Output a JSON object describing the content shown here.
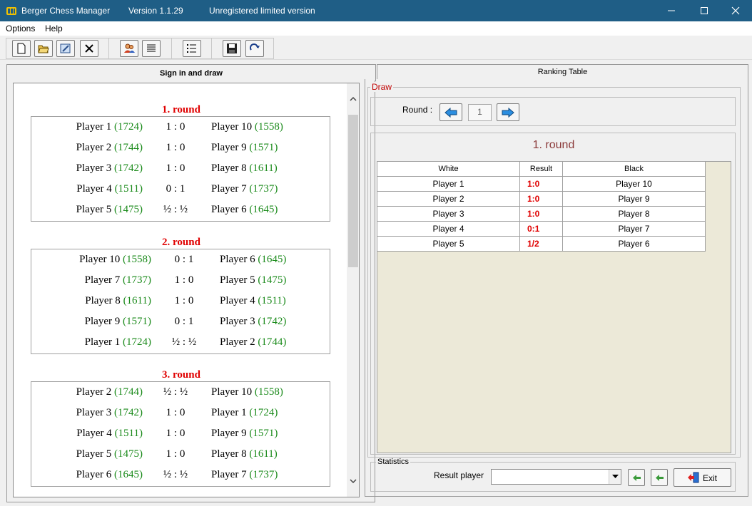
{
  "titlebar": {
    "app_name": "Berger Chess Manager",
    "version": "Version 1.1.29",
    "license": "Unregistered limited version"
  },
  "menu": [
    "Options",
    "Help"
  ],
  "toolbar": {
    "buttons": [
      "new-document-icon",
      "open-folder-icon",
      "edit-icon",
      "delete-icon",
      "players-icon",
      "align-text-icon",
      "list-icon",
      "save-icon",
      "redo-icon"
    ]
  },
  "tabs": {
    "signin": "Sign in and draw",
    "ranking": "Ranking Table"
  },
  "rounds": [
    {
      "title": "1. round",
      "games": [
        {
          "white": "Player 1",
          "white_elo": "(1724)",
          "result": "1 : 0",
          "black": "Player 10",
          "black_elo": "(1558)"
        },
        {
          "white": "Player 2",
          "white_elo": "(1744)",
          "result": "1 : 0",
          "black": "Player 9",
          "black_elo": "(1571)"
        },
        {
          "white": "Player 3",
          "white_elo": "(1742)",
          "result": "1 : 0",
          "black": "Player 8",
          "black_elo": "(1611)"
        },
        {
          "white": "Player 4",
          "white_elo": "(1511)",
          "result": "0 : 1",
          "black": "Player 7",
          "black_elo": "(1737)"
        },
        {
          "white": "Player 5",
          "white_elo": "(1475)",
          "result": "½ : ½",
          "black": "Player 6",
          "black_elo": "(1645)"
        }
      ]
    },
    {
      "title": "2. round",
      "games": [
        {
          "white": "Player 10",
          "white_elo": "(1558)",
          "result": "0 : 1",
          "black": "Player 6",
          "black_elo": "(1645)"
        },
        {
          "white": "Player 7",
          "white_elo": "(1737)",
          "result": "1 : 0",
          "black": "Player 5",
          "black_elo": "(1475)"
        },
        {
          "white": "Player 8",
          "white_elo": "(1611)",
          "result": "1 : 0",
          "black": "Player 4",
          "black_elo": "(1511)"
        },
        {
          "white": "Player 9",
          "white_elo": "(1571)",
          "result": "0 : 1",
          "black": "Player 3",
          "black_elo": "(1742)"
        },
        {
          "white": "Player 1",
          "white_elo": "(1724)",
          "result": "½ : ½",
          "black": "Player 2",
          "black_elo": "(1744)"
        }
      ]
    },
    {
      "title": "3. round",
      "games": [
        {
          "white": "Player 2",
          "white_elo": "(1744)",
          "result": "½ : ½",
          "black": "Player 10",
          "black_elo": "(1558)"
        },
        {
          "white": "Player 3",
          "white_elo": "(1742)",
          "result": "1 : 0",
          "black": "Player 1",
          "black_elo": "(1724)"
        },
        {
          "white": "Player 4",
          "white_elo": "(1511)",
          "result": "1 : 0",
          "black": "Player 9",
          "black_elo": "(1571)"
        },
        {
          "white": "Player 5",
          "white_elo": "(1475)",
          "result": "1 : 0",
          "black": "Player 8",
          "black_elo": "(1611)"
        },
        {
          "white": "Player 6",
          "white_elo": "(1645)",
          "result": "½ : ½",
          "black": "Player 7",
          "black_elo": "(1737)"
        }
      ]
    }
  ],
  "draw": {
    "group_label": "Draw",
    "round_label": "Round :",
    "round_value": "1",
    "heading": "1. round",
    "table": {
      "headers": [
        "White",
        "Result",
        "Black"
      ],
      "rows": [
        {
          "white": "Player 1",
          "result": "1:0",
          "black": "Player 10"
        },
        {
          "white": "Player 2",
          "result": "1:0",
          "black": "Player 9"
        },
        {
          "white": "Player 3",
          "result": "1:0",
          "black": "Player 8"
        },
        {
          "white": "Player 4",
          "result": "0:1",
          "black": "Player 7"
        },
        {
          "white": "Player 5",
          "result": "1/2",
          "black": "Player 6"
        }
      ]
    }
  },
  "statistics": {
    "group_label": "Statistics",
    "result_player_label": "Result player",
    "selected": "",
    "exit_label": "Exit"
  },
  "colors": {
    "titlebar": "#1f5e86",
    "round_title": "#e00000",
    "elo": "#1a8a1a",
    "heading": "#8b3a3a"
  }
}
